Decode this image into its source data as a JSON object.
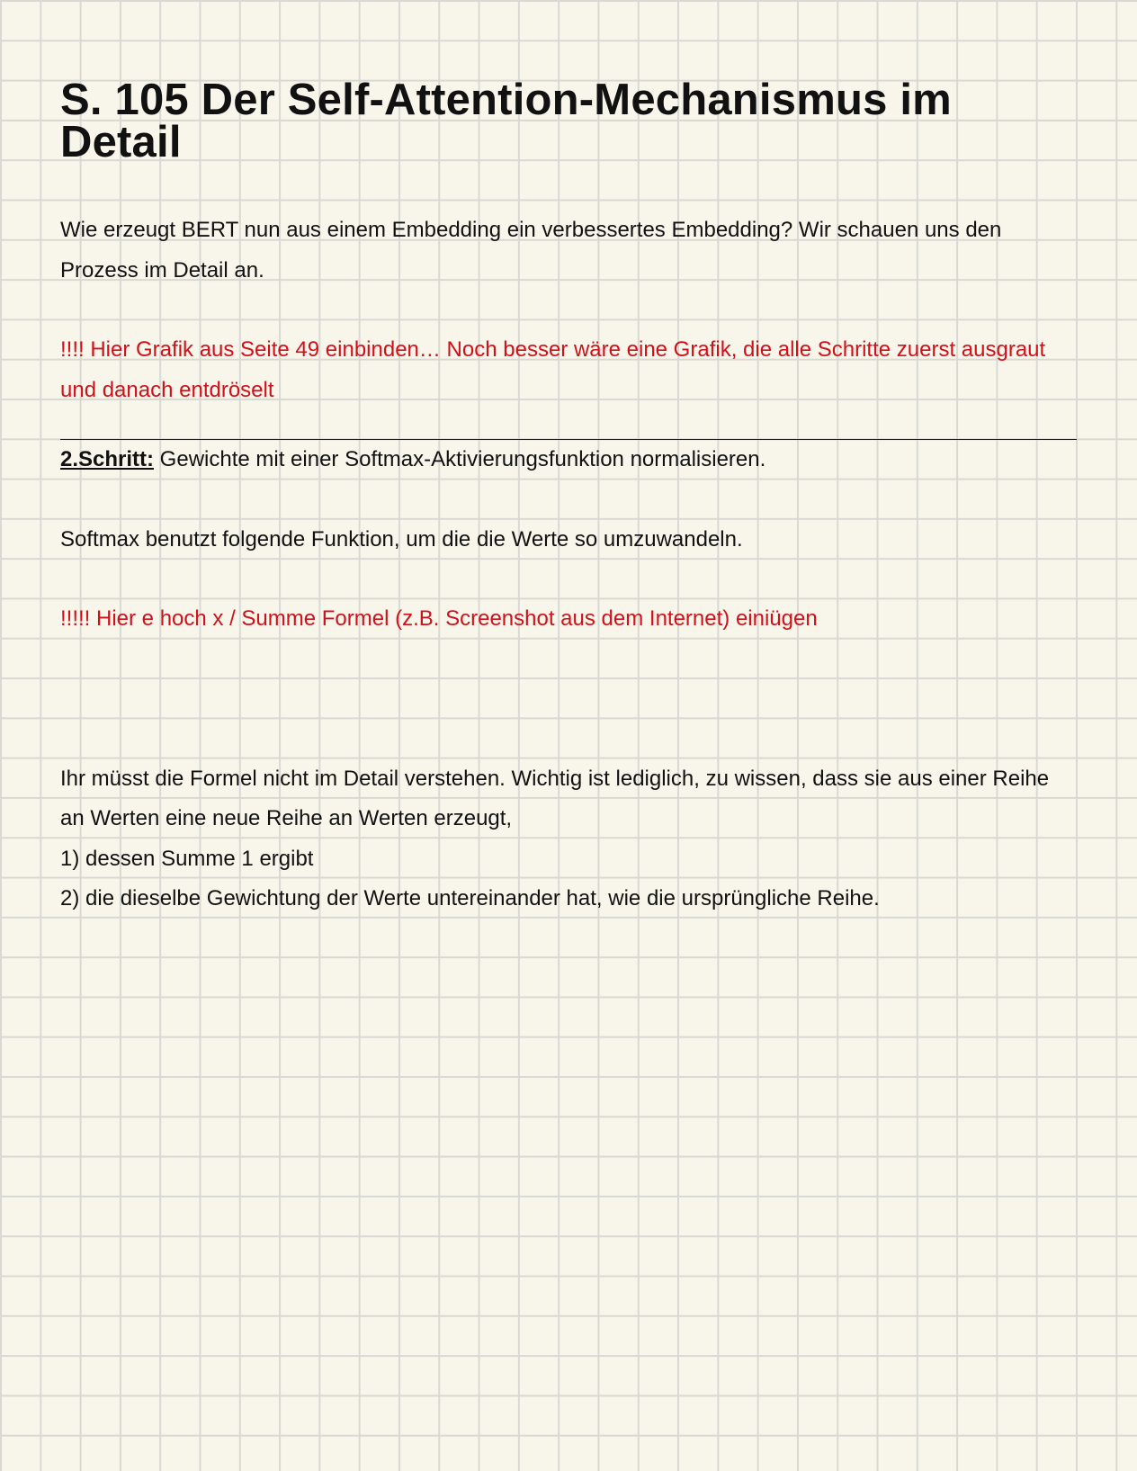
{
  "title": "S. 105 Der Self-Attention-Mechanismus im Detail",
  "intro": "Wie erzeugt BERT nun aus einem Embedding ein verbessertes Embedding? Wir schauen uns den Prozess im Detail an.",
  "note_graphic": "!!!! Hier Grafik aus Seite 49 einbinden… Noch besser wäre eine Grafik, die alle Schritte zuerst ausgraut und danach entdröselt",
  "step": {
    "label": "2.Schritt:",
    "text": " Gewichte mit einer Softmax-Aktivierungsfunktion normalisieren."
  },
  "softmax_text": "Softmax benutzt folgende Funktion, um die die Werte so umzuwandeln.",
  "note_formula": "!!!!! Hier e hoch x / Summe Formel (z.B. Screenshot aus dem Internet) einiügen",
  "explanation": {
    "text": "Ihr müsst die Formel nicht im Detail verstehen. Wichtig ist lediglich, zu wissen, dass sie aus einer Reihe an Werten eine neue Reihe an Werten erzeugt,",
    "items": [
      "1) dessen Summe 1 ergibt",
      "2) die dieselbe Gewichtung der Werte untereinander hat, wie die ursprüngliche Reihe."
    ]
  },
  "colors": {
    "background": "#f8f6ea",
    "grid": "#d9d9d4",
    "note_red": "#d0101a",
    "text": "#111111"
  }
}
